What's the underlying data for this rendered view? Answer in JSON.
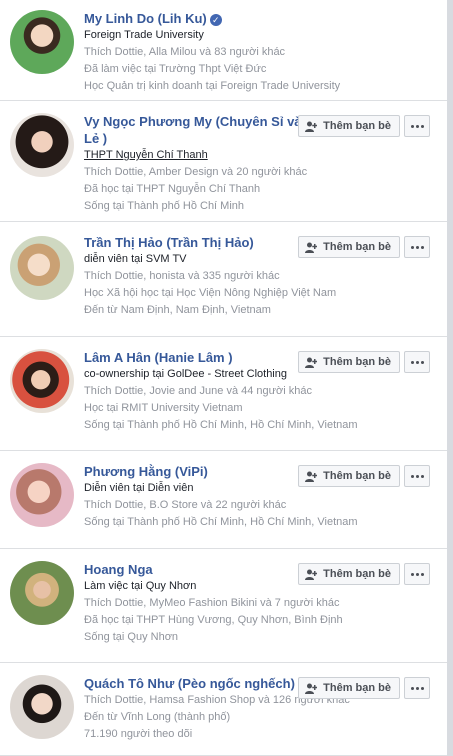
{
  "colors": {
    "name_link": "#365899",
    "meta_text": "#90949c",
    "verified_badge": "#4267b2",
    "button_bg": "#f6f7f9"
  },
  "button": {
    "add_friend_label": "Thêm bạn bè",
    "add_friend_icon": "person-add-icon",
    "more_icon": "more-horizontal-icon"
  },
  "people": [
    {
      "name": "My Linh Do (Lih Ku)",
      "verified": true,
      "lines": [
        "Foreign Trade University",
        "Thích Dottie, Alla Milou và 83 người khác",
        "Đã làm việc tại Trường Thpt Việt Đức",
        "Học Quản trị kinh doanh tại Foreign Trade University"
      ]
    },
    {
      "name": "Vy Ngọc Phương My (Chuyên Sỉ và Lẻ )",
      "lines": [
        "THPT Nguyễn Chí Thanh",
        "Thích Dottie, Amber Design và 20 người khác",
        "Đã học tại THPT Nguyễn Chí Thanh",
        "Sống tại Thành phố Hồ Chí Minh"
      ]
    },
    {
      "name": "Trần Thị Hảo (Trần Thị Hảo)",
      "lines": [
        "diễn viên tại SVM TV",
        "Thích Dottie, honista và 335 người khác",
        "Học Xã hội học tại Học Viện Nông Nghiệp Việt Nam",
        "Đến từ Nam Định, Nam Định, Vietnam"
      ]
    },
    {
      "name": "Lâm A Hân (Hanie Lâm )",
      "lines": [
        "co-ownership tại GolDee - Street Clothing",
        "Thích Dottie, Jovie and June và 44 người khác",
        "Học tại RMIT University Vietnam",
        "Sống tại Thành phố Hồ Chí Minh, Hồ Chí Minh, Vietnam"
      ]
    },
    {
      "name": "Phương Hằng (ViPi)",
      "lines": [
        "Diễn viên tại Diễn viên",
        "Thích Dottie, B.O Store và 22 người khác",
        "Sống tại Thành phố Hồ Chí Minh, Hồ Chí Minh, Vietnam"
      ]
    },
    {
      "name": "Hoang Nga",
      "lines": [
        "Làm việc tại Quy Nhơn",
        "Thích Dottie, MyMeo Fashion Bikini và 7 người khác",
        "Đã học tại THPT Hùng Vương, Quy Nhơn, Bình Định",
        "Sống tại Quy Nhơn"
      ]
    },
    {
      "name": "Quách Tô Như (Pèo ngốc nghếch)",
      "lines": [
        "Thích Dottie, Hamsa Fashion Shop và 126 người khác",
        "Đến từ Vĩnh Long (thành phố)",
        "71.190 người theo dõi"
      ]
    }
  ]
}
